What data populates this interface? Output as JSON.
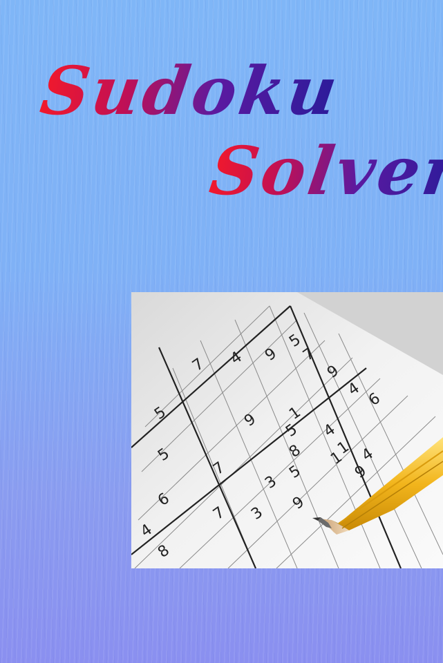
{
  "title": {
    "line1": "Sudoku",
    "line2": "Solver"
  },
  "colors": {
    "title_start": "#f2192b",
    "title_end": "#2a1b9a",
    "background": "#7fb6f7"
  },
  "image": {
    "icon": "sudoku-pencil-photo",
    "digits": [
      "7",
      "4",
      "9",
      "5",
      "7",
      "9",
      "4",
      "6",
      "5",
      "1",
      "9",
      "5",
      "4",
      "1",
      "5",
      "8",
      "1",
      "7",
      "3",
      "5",
      "9",
      "4",
      "6",
      "7",
      "3",
      "9",
      "1",
      "4",
      "8"
    ]
  }
}
